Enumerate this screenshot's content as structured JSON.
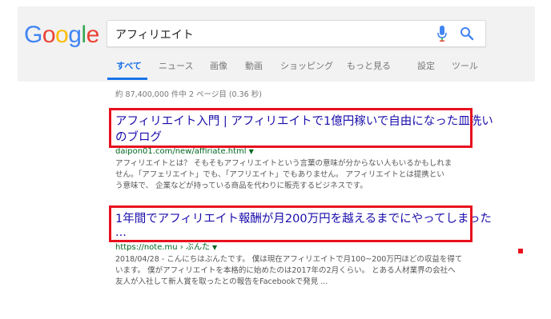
{
  "logo": {
    "letters": [
      "G",
      "o",
      "o",
      "g",
      "l",
      "e"
    ]
  },
  "search": {
    "query": "アフィリエイト"
  },
  "tabs": [
    {
      "label": "すべて"
    },
    {
      "label": "ニュース"
    },
    {
      "label": "画像"
    },
    {
      "label": "動画"
    },
    {
      "label": "ショッピング"
    },
    {
      "label": "もっと見る"
    },
    {
      "label": "設定"
    },
    {
      "label": "ツール"
    }
  ],
  "stats": "約 87,400,000 件中 2 ページ目 (0.36 秒)",
  "results": [
    {
      "title_line1": "アフィリエイト入門 | アフィリエイトで1億円稼いで自由になった皿洗い",
      "title_line2": "のブログ",
      "url": "daipon01.com/new/affiriate.html",
      "snippet": [
        "アフィリエイトとは？ そもそもアフィリエイトという言葉の意味が分からない人もいるかもしれま",
        "せん。「アフェリエイト」でも、「アフリエイト」でもありません。 アフィリエイトとは提携とい",
        "う意味で、 企業などが持っている商品を代わりに販売するビジネスです。"
      ]
    },
    {
      "title_line1": "1年間でアフィリエイト報酬が月200万円を越えるまでにやってしまった",
      "title_line2": "...",
      "url": "https://note.mu › ぶんた",
      "snippet": [
        "2018/04/28 - こんにちはぶんたです。 僕は現在アフィリエイトで月100~200万円ほどの収益を得て",
        "います。 僕がアフィリエイトを本格的に始めたのは2017年の2月くらい。 とある人材業界の会社へ",
        "友人が入社して新人賞を取ったとの報告をFacebookで発見 ..."
      ]
    }
  ],
  "colors": {
    "link": "#1a0dab",
    "url": "#006621",
    "active_tab": "#1a73e8",
    "highlight": "#e8111e",
    "google_blue": "#4285f4",
    "google_red": "#ea4335",
    "google_yellow": "#fbbc05",
    "google_green": "#34a853"
  }
}
